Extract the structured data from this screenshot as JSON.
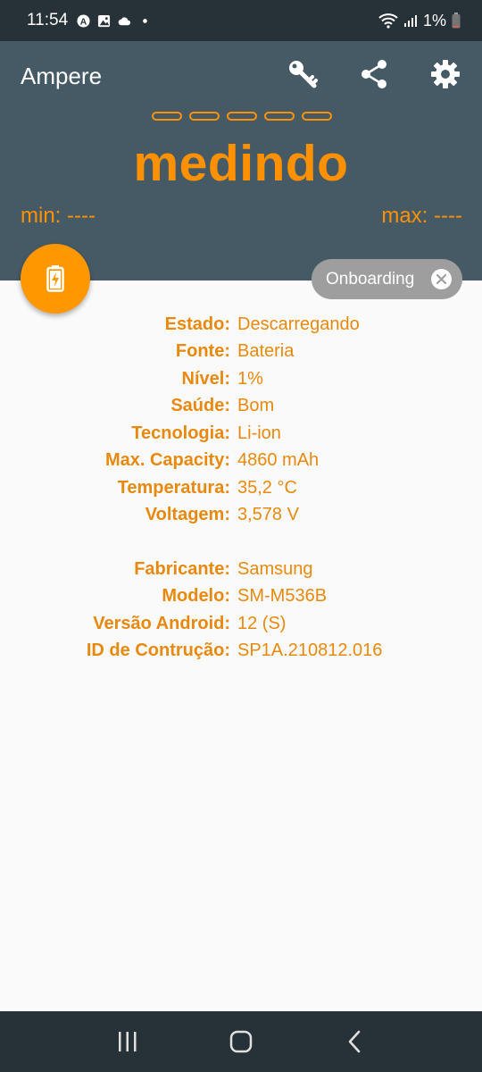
{
  "status_bar": {
    "time": "11:54",
    "battery": "1%",
    "icons_left": [
      "a-circle-icon",
      "image-icon",
      "cloud-icon",
      "dot-icon"
    ],
    "icons_right": [
      "wifi-icon",
      "signal-icon",
      "battery-icon"
    ]
  },
  "header": {
    "app_title": "Ampere",
    "actions": [
      "key-icon",
      "share-icon",
      "gear-icon"
    ],
    "status": "medindo",
    "min": "min: ----",
    "max": "max: ----"
  },
  "chip": {
    "label": "Onboarding"
  },
  "info": {
    "battery": [
      {
        "label": "Estado:",
        "value": "Descarregando"
      },
      {
        "label": "Fonte:",
        "value": "Bateria"
      },
      {
        "label": "Nível:",
        "value": "1%"
      },
      {
        "label": "Saúde:",
        "value": "Bom"
      },
      {
        "label": "Tecnologia:",
        "value": "Li-ion"
      },
      {
        "label": "Max. Capacity:",
        "value": "4860 mAh"
      },
      {
        "label": "Temperatura:",
        "value": "35,2 °C"
      },
      {
        "label": "Voltagem:",
        "value": "3,578 V"
      }
    ],
    "device": [
      {
        "label": "Fabricante:",
        "value": "Samsung"
      },
      {
        "label": "Modelo:",
        "value": "SM-M536B"
      },
      {
        "label": "Versão Android:",
        "value": "12 (S)"
      },
      {
        "label": "ID de Contrução:",
        "value": "SP1A.210812.016"
      }
    ]
  },
  "colors": {
    "accent": "#ff9100",
    "header": "#465a66",
    "bars": "#263238"
  }
}
